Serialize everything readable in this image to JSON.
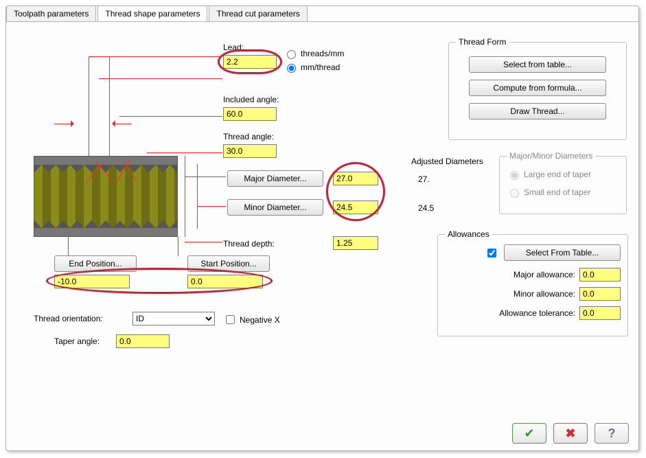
{
  "tabs": {
    "toolpath": "Toolpath parameters",
    "shape": "Thread shape parameters",
    "cut": "Thread cut parameters"
  },
  "lead": {
    "label": "Lead:",
    "value": "2.2",
    "radio_threads_mm": "threads/mm",
    "radio_mm_thread": "mm/thread"
  },
  "included_angle": {
    "label": "Included angle:",
    "value": "60.0"
  },
  "thread_angle": {
    "label": "Thread angle:",
    "value": "30.0"
  },
  "major_btn": "Major Diameter...",
  "minor_btn": "Minor Diameter...",
  "major_value": "27.0",
  "minor_value": "24.5",
  "thread_depth": {
    "label": "Thread depth:",
    "value": "1.25"
  },
  "end_position_btn": "End Position...",
  "start_position_btn": "Start Position...",
  "end_position_value": "-10.0",
  "start_position_value": "0.0",
  "thread_orientation": {
    "label": "Thread orientation:",
    "value": "ID"
  },
  "negative_x": "Negative X",
  "taper_angle": {
    "label": "Taper angle:",
    "value": "0.0"
  },
  "thread_form": {
    "legend": "Thread Form",
    "select_table": "Select from table...",
    "compute": "Compute from formula...",
    "draw": "Draw Thread..."
  },
  "adjusted_diameters": {
    "label": "Adjusted Diameters",
    "major": "27.",
    "minor": "24.5"
  },
  "major_minor_diameters": {
    "legend": "Major/Minor Diameters",
    "large": "Large end of taper",
    "small": "Small end of taper"
  },
  "allowances": {
    "legend": "Allowances",
    "select_btn": "Select From Table...",
    "major_label": "Major allowance:",
    "major_value": "0.0",
    "minor_label": "Minor allowance:",
    "minor_value": "0.0",
    "tol_label": "Allowance tolerance:",
    "tol_value": "0.0"
  }
}
